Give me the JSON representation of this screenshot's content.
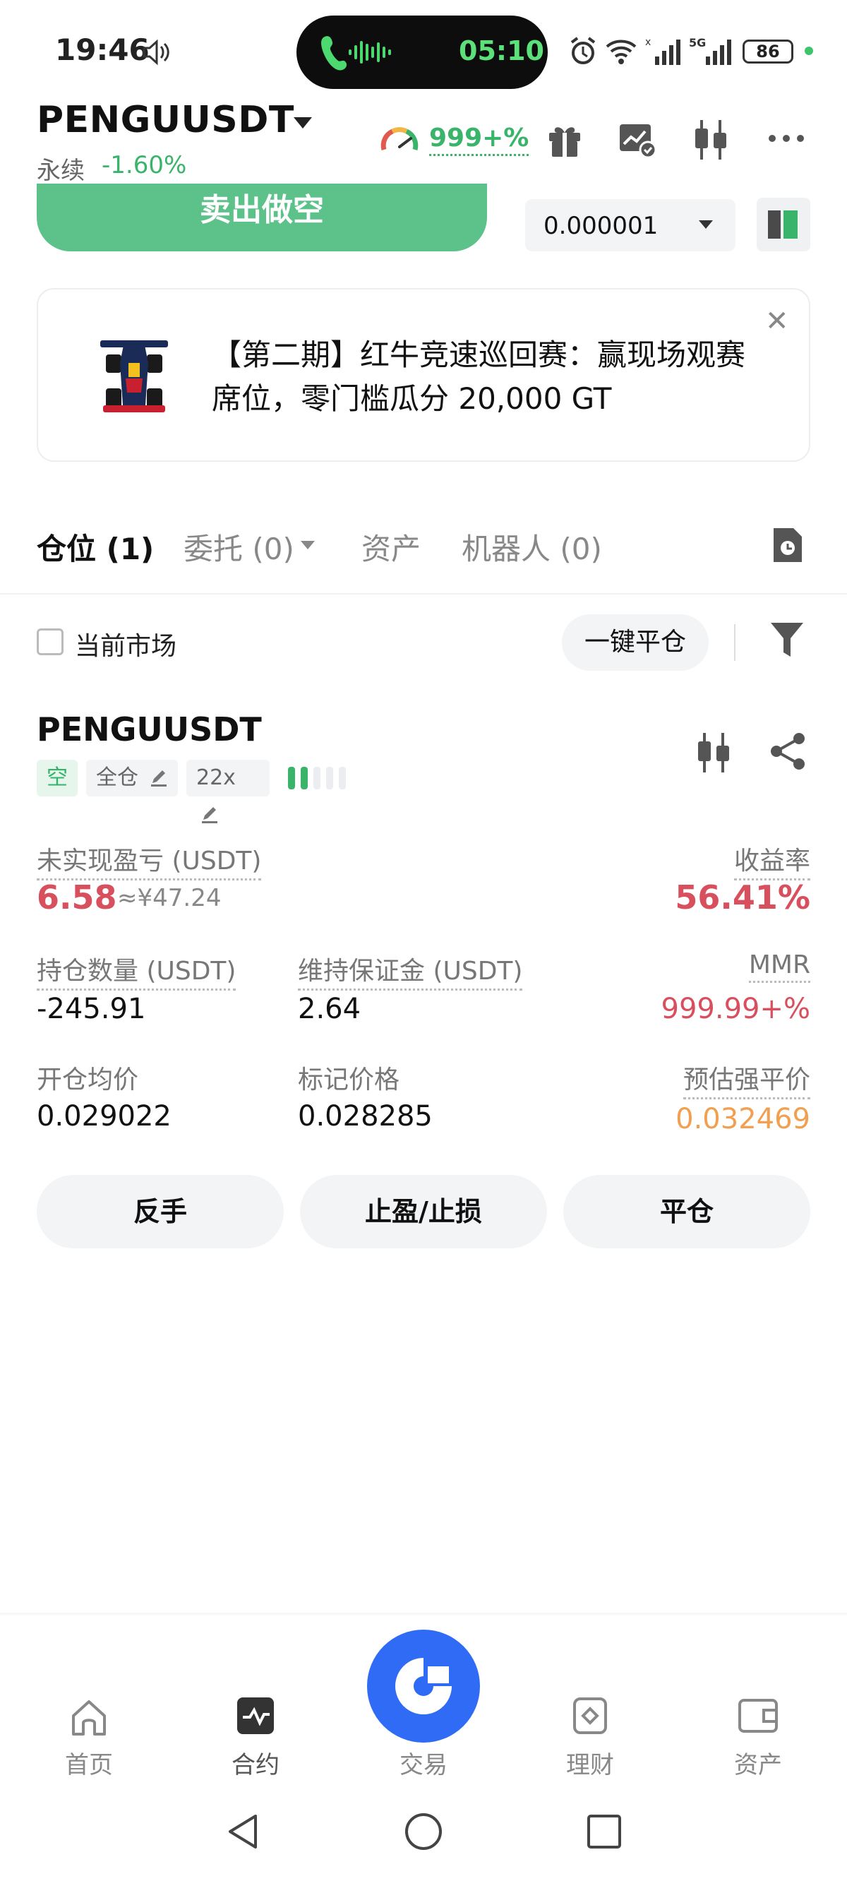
{
  "status_bar": {
    "time": "19:46",
    "call_timer": "05:10",
    "network": "5G",
    "battery": "86"
  },
  "header": {
    "symbol": "PENGUUSDT",
    "contract_type": "永续",
    "change": "-1.60%",
    "gauge_value": "999+%",
    "icons": [
      "gift-icon",
      "chart-check-icon",
      "candlestick-icon",
      "more-icon"
    ]
  },
  "order": {
    "sell_short_label": "卖出做空",
    "qty_value": "0.000001"
  },
  "banner": {
    "text": "【第二期】红牛竞速巡回赛：赢现场观赛席位，零门槛瓜分 20,000 GT"
  },
  "tabs": [
    {
      "label": "仓位 (1)"
    },
    {
      "label": "委托 (0)"
    },
    {
      "label": "资产"
    },
    {
      "label": "机器人 (0)"
    }
  ],
  "filter": {
    "current_market": "当前市场",
    "close_all": "一键平仓"
  },
  "position": {
    "symbol": "PENGUUSDT",
    "side_tag": "空",
    "margin_tag": "全仓",
    "leverage_tag": "22x",
    "unrealized_label": "未实现盈亏 (USDT)",
    "unrealized_value": "6.58",
    "unrealized_cny": "≈¥47.24",
    "roe_label": "收益率",
    "roe_value": "56.41%",
    "size_label": "持仓数量 (USDT)",
    "size_value": "-245.91",
    "maint_label": "维持保证金 (USDT)",
    "maint_value": "2.64",
    "mmr_label": "MMR",
    "mmr_value": "999.99+%",
    "entry_label": "开仓均价",
    "entry_value": "0.029022",
    "mark_label": "标记价格",
    "mark_value": "0.028285",
    "liq_label": "预估强平价",
    "liq_value": "0.032469"
  },
  "actions": {
    "reverse": "反手",
    "tp_sl": "止盈/止损",
    "close": "平仓"
  },
  "bottom_nav": [
    {
      "label": "首页",
      "icon": "home-icon"
    },
    {
      "label": "合约",
      "icon": "futures-icon"
    },
    {
      "label": "交易",
      "icon": "trade-icon"
    },
    {
      "label": "理财",
      "icon": "earn-icon"
    },
    {
      "label": "资产",
      "icon": "wallet-icon"
    }
  ],
  "colors": {
    "green": "#3bb46b",
    "red": "#d8505e",
    "orange": "#f0a050",
    "blue": "#2f6bf5",
    "sell_button": "#5cc28a"
  }
}
